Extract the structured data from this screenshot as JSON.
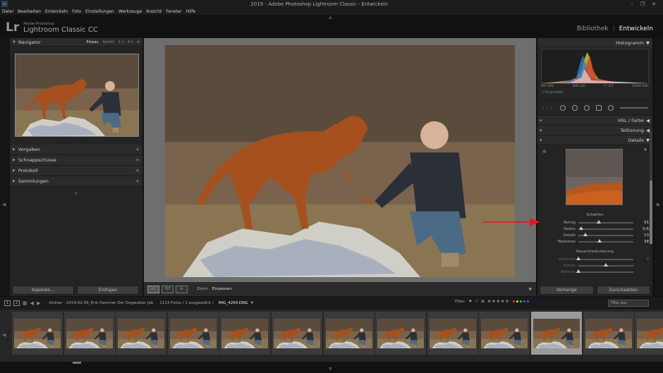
{
  "window": {
    "title": "2019 - Adobe Photoshop Lightroom Classic - Entwickeln",
    "badge": "Lr",
    "controls": [
      "–",
      "❐",
      "✕"
    ]
  },
  "menu": [
    "Datei",
    "Bearbeiten",
    "Entwickeln",
    "Foto",
    "Einstellungen",
    "Werkzeuge",
    "Ansicht",
    "Fenster",
    "Hilfe"
  ],
  "identity": {
    "mark": "Lr",
    "vendor": "Adobe Photoshop",
    "product": "Lightroom Classic CC",
    "modules": [
      "Bibliothek",
      "Entwickeln"
    ],
    "active_module": "Entwickeln"
  },
  "navigator": {
    "title": "Navigator",
    "zoom_options": [
      "Einpas.",
      "Ausfül.",
      "1:1",
      "4:1"
    ]
  },
  "left_sections": [
    "Vorgaben",
    "Schnappschüsse",
    "Protokoll",
    "Sammlungen"
  ],
  "left_buttons": {
    "copy": "Kopieren...",
    "paste": "Einfügen"
  },
  "toolbar": {
    "zoom_label": "Zoom",
    "zoom_value": "Einpassen"
  },
  "histogram": {
    "title": "Histogramm",
    "iso": "ISO 200",
    "focal": "300 mm",
    "aperture": "f / 4,5",
    "shutter": "1/500 Sek.",
    "original_label": "Originalfoto"
  },
  "right_sections": {
    "hsl": "HSL / Farbe",
    "split": "Teiltonung",
    "details": "Details"
  },
  "sharpening": {
    "title": "Schärfen",
    "sliders": [
      {
        "label": "Betrag",
        "value": "55",
        "fraction": 0.37
      },
      {
        "label": "Radius",
        "value": "0,6",
        "fraction": 0.05
      },
      {
        "label": "Details",
        "value": "13",
        "fraction": 0.13
      },
      {
        "label": "Maskieren",
        "value": "38",
        "fraction": 0.38
      }
    ]
  },
  "noise": {
    "title": "Rauschreduzierung",
    "sliders": [
      {
        "label": "Luminanz",
        "value": "0",
        "fraction": 0.0
      },
      {
        "label": "Details",
        "value": "",
        "fraction": 0.5
      },
      {
        "label": "Kontrast",
        "value": "",
        "fraction": 0.0
      }
    ]
  },
  "right_buttons": {
    "previous": "Vorherige",
    "reset": "Zurücksetzen"
  },
  "filmbar": {
    "folder": "Ordner : 2019-02-06_Erik Hammer Der Dogwalker Job",
    "count": "1113 Fotos / 1 ausgewählt /",
    "file": "IMG_4264.DNG",
    "filter_label": "Filter:",
    "stars": "★★★★★",
    "filter_off": "Filter aus"
  },
  "colors": {
    "accent_arrow": "#e0191d",
    "panel_bg": "#242424",
    "center_bg": "#6e6e6e"
  },
  "filmstrip": {
    "cell_count": 13,
    "selected_index": 10
  }
}
